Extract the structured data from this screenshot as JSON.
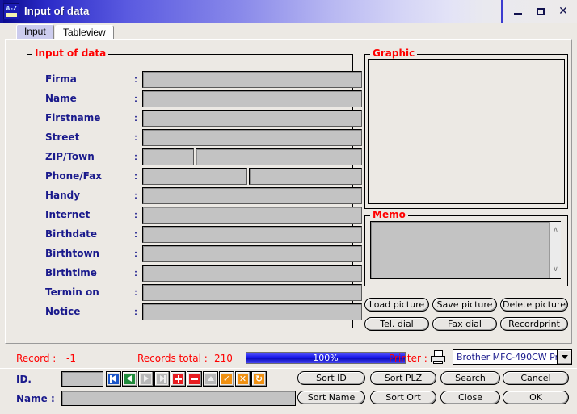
{
  "window": {
    "title": "Input of data",
    "icon": "az-sort-icon",
    "buttons": {
      "minimize": "minimize",
      "maximize": "maximize",
      "close": "close"
    }
  },
  "tabs": [
    {
      "label": "Input",
      "active": true
    },
    {
      "label": "Tableview",
      "active": false
    }
  ],
  "groups": {
    "input": {
      "caption": "Input of data"
    },
    "graphic": {
      "caption": "Graphic"
    },
    "memo": {
      "caption": "Memo"
    }
  },
  "form": {
    "colon": ":",
    "fields": [
      {
        "label": "Firma",
        "value": "",
        "layout": "full"
      },
      {
        "label": "Name",
        "value": "",
        "layout": "full"
      },
      {
        "label": "Firstname",
        "value": "",
        "layout": "full"
      },
      {
        "label": "Street",
        "value": "",
        "layout": "full"
      },
      {
        "label": "ZIP/Town",
        "value": "",
        "layout": "split-small",
        "value2": ""
      },
      {
        "label": "Phone/Fax",
        "value": "",
        "layout": "split-half",
        "value2": ""
      },
      {
        "label": "Handy",
        "value": "",
        "layout": "full"
      },
      {
        "label": "Internet",
        "value": "",
        "layout": "full"
      },
      {
        "label": "Birthdate",
        "value": "",
        "layout": "full"
      },
      {
        "label": "Birthtown",
        "value": "",
        "layout": "full"
      },
      {
        "label": "Birthtime",
        "value": "",
        "layout": "full"
      },
      {
        "label": "Termin on",
        "value": "",
        "layout": "full"
      },
      {
        "label": "Notice",
        "value": "",
        "layout": "full"
      }
    ]
  },
  "memo": {
    "value": "",
    "scrollbar": {
      "up": "∧",
      "down": "∨"
    }
  },
  "picture_buttons": [
    {
      "label": "Load picture"
    },
    {
      "label": "Save picture"
    },
    {
      "label": "Delete picture"
    },
    {
      "label": "Tel. dial"
    },
    {
      "label": "Fax dial"
    },
    {
      "label": "Recordprint"
    }
  ],
  "status": {
    "record_label": "Record :",
    "record_value": "-1",
    "total_label": "Records total :",
    "total_value": "210",
    "progress_text": "100%",
    "progress_percent": 100,
    "printer_label": "Printer :",
    "printer_icon": "printer-icon",
    "printer_value": "Brother MFC-490CW Pr"
  },
  "bottom": {
    "id_label": "ID.",
    "id_value": "",
    "name_label": "Name  :",
    "name_value": "",
    "navigator": [
      {
        "name": "first",
        "color": "blue",
        "glyph": "first",
        "enabled": true
      },
      {
        "name": "prior",
        "color": "green",
        "glyph": "prior",
        "enabled": true
      },
      {
        "name": "next",
        "color": "gray",
        "glyph": "next",
        "enabled": false
      },
      {
        "name": "last",
        "color": "gray",
        "glyph": "last",
        "enabled": false
      },
      {
        "name": "insert",
        "color": "red",
        "glyph": "plus",
        "enabled": true
      },
      {
        "name": "delete",
        "color": "red",
        "glyph": "minus",
        "enabled": true
      },
      {
        "name": "edit",
        "color": "gray",
        "glyph": "edit",
        "enabled": false
      },
      {
        "name": "post",
        "color": "orange",
        "glyph": "check",
        "enabled": true
      },
      {
        "name": "cancel",
        "color": "orange",
        "glyph": "cross",
        "enabled": true
      },
      {
        "name": "refresh",
        "color": "orange",
        "glyph": "refresh",
        "enabled": true
      }
    ],
    "action_buttons": [
      {
        "label": "Sort ID",
        "accel": "ID"
      },
      {
        "label": "Sort PLZ",
        "accel": "PLZ"
      },
      {
        "label": "Search",
        "accel": "S"
      },
      {
        "label": "Cancel",
        "accel": "C"
      },
      {
        "label": "Sort Name",
        "accel": "Name"
      },
      {
        "label": "Sort Ort",
        "accel": "Ort"
      },
      {
        "label": "Close",
        "accel": "l"
      },
      {
        "label": "OK",
        "accel": "OK"
      }
    ]
  },
  "colors": {
    "titlebar_start": "#0a0a8c",
    "label_blue": "#1a1a8c",
    "caption_red": "#ff0000",
    "field_gray": "#c3c3c3",
    "window_bg": "#ece9e4",
    "progress_blue": "#1414e6"
  }
}
